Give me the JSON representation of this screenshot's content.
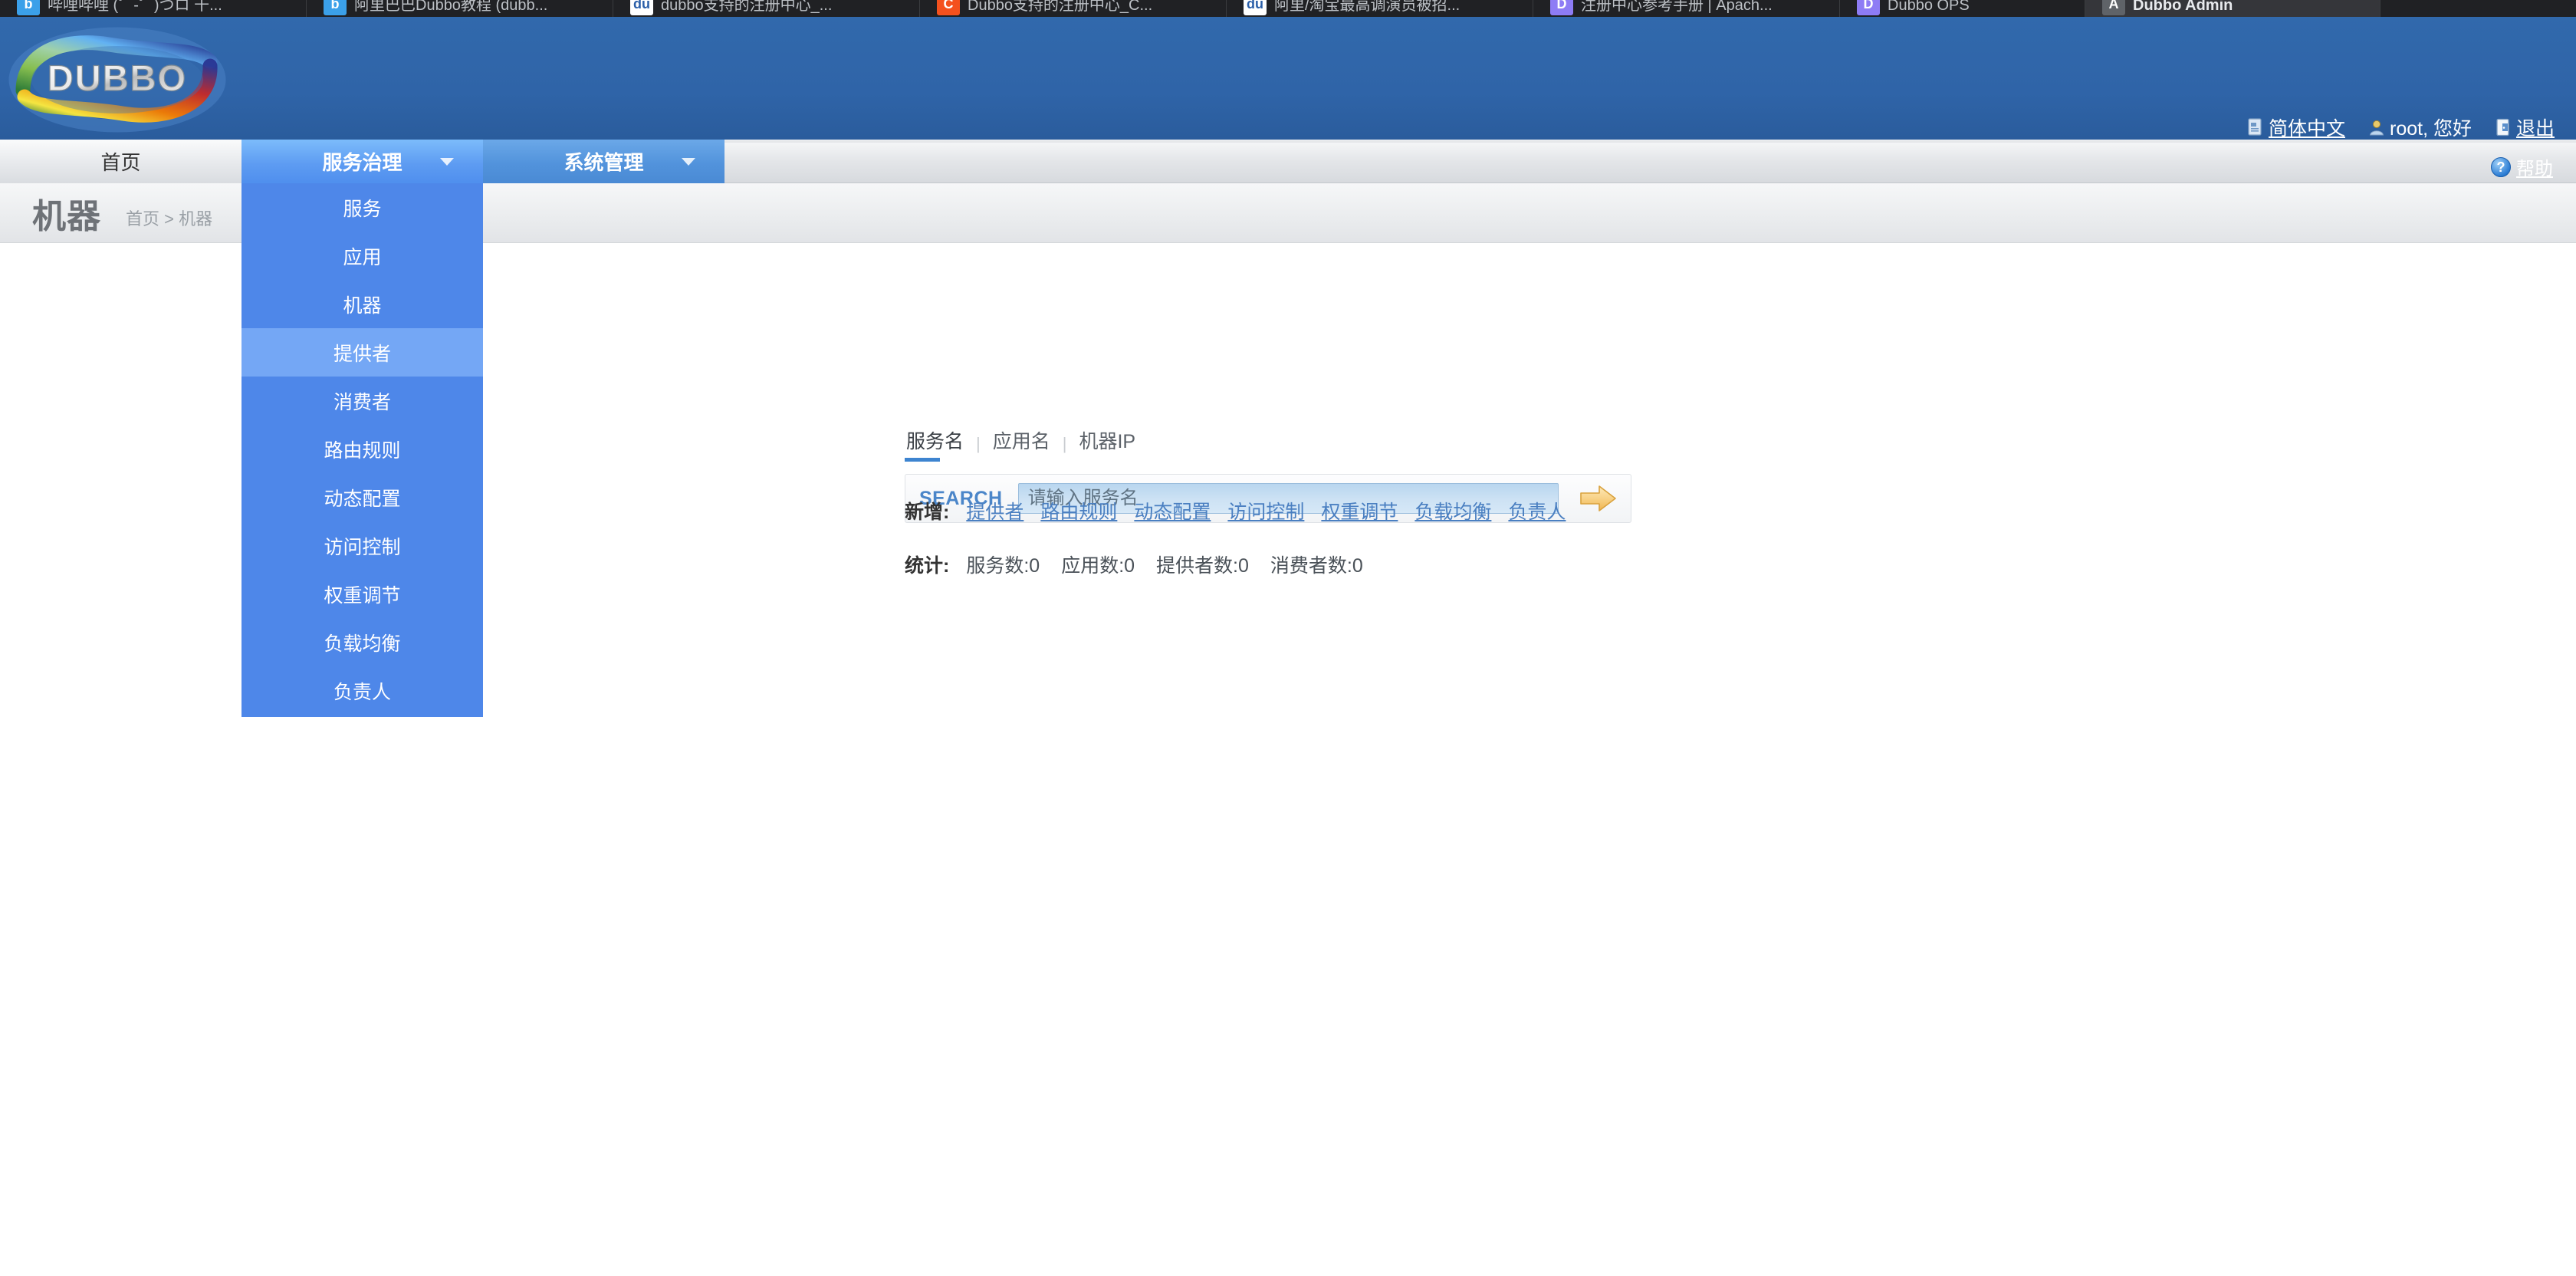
{
  "browser": {
    "tabs": [
      {
        "title": "哔哩哔哩 (゜-゜)つロ 干...",
        "favicon_text": "b",
        "favicon_color": "#3BA0E9",
        "active": false
      },
      {
        "title": "阿里巴巴Dubbo教程 (dubb...",
        "favicon_text": "b",
        "favicon_color": "#3BA0E9",
        "active": false
      },
      {
        "title": "dubbo支持的注册中心_...",
        "favicon_text": "du",
        "favicon_color": "#ffffff",
        "active": false
      },
      {
        "title": "Dubbo支持的注册中心_C...",
        "favicon_text": "C",
        "favicon_color": "#F4511E",
        "active": false
      },
      {
        "title": "阿里/淘宝最高调演员被招...",
        "favicon_text": "du",
        "favicon_color": "#ffffff",
        "active": false
      },
      {
        "title": "注册中心参考手册 | Apach...",
        "favicon_text": "D",
        "favicon_color": "#8E7CF5",
        "active": false
      },
      {
        "title": "Dubbo OPS",
        "favicon_text": "D",
        "favicon_color": "#8E7CF5",
        "active": false
      },
      {
        "title": "Dubbo Admin",
        "favicon_text": "A",
        "favicon_color": "#5f6368",
        "active": true
      }
    ]
  },
  "header": {
    "logo_text": "DUBBO",
    "language_label": "简体中文",
    "user_label": "root, 您好",
    "logout_label": "退出",
    "help_label": "帮助",
    "accent_color": "#2F64A8"
  },
  "nav": {
    "items": [
      {
        "label": "首页",
        "style": "home",
        "caret": false
      },
      {
        "label": "服务治理",
        "style": "active",
        "caret": true
      },
      {
        "label": "系统管理",
        "style": "plain-blue",
        "caret": true
      }
    ]
  },
  "dropdown": {
    "items": [
      {
        "label": "服务",
        "selected": false
      },
      {
        "label": "应用",
        "selected": false
      },
      {
        "label": "机器",
        "selected": false
      },
      {
        "label": "提供者",
        "selected": true
      },
      {
        "label": "消费者",
        "selected": false
      },
      {
        "label": "路由规则",
        "selected": false
      },
      {
        "label": "动态配置",
        "selected": false
      },
      {
        "label": "访问控制",
        "selected": false
      },
      {
        "label": "权重调节",
        "selected": false
      },
      {
        "label": "负载均衡",
        "selected": false
      },
      {
        "label": "负责人",
        "selected": false
      }
    ]
  },
  "page": {
    "title": "机器",
    "breadcrumb": "首页 > 机器"
  },
  "search": {
    "tabs": [
      {
        "label": "服务名",
        "active": true
      },
      {
        "label": "应用名",
        "active": false
      },
      {
        "label": "机器IP",
        "active": false
      }
    ],
    "separator": "|",
    "label": "SEARCH",
    "placeholder": "请输入服务名",
    "value": "",
    "submit_icon": "arrow-right-icon"
  },
  "actions": {
    "label": "新增:",
    "links": [
      "提供者",
      "路由规则",
      "动态配置",
      "访问控制",
      "权重调节",
      "负载均衡",
      "负责人"
    ]
  },
  "stats": {
    "label": "统计:",
    "items": [
      "服务数:0",
      "应用数:0",
      "提供者数:0",
      "消费者数:0"
    ]
  }
}
